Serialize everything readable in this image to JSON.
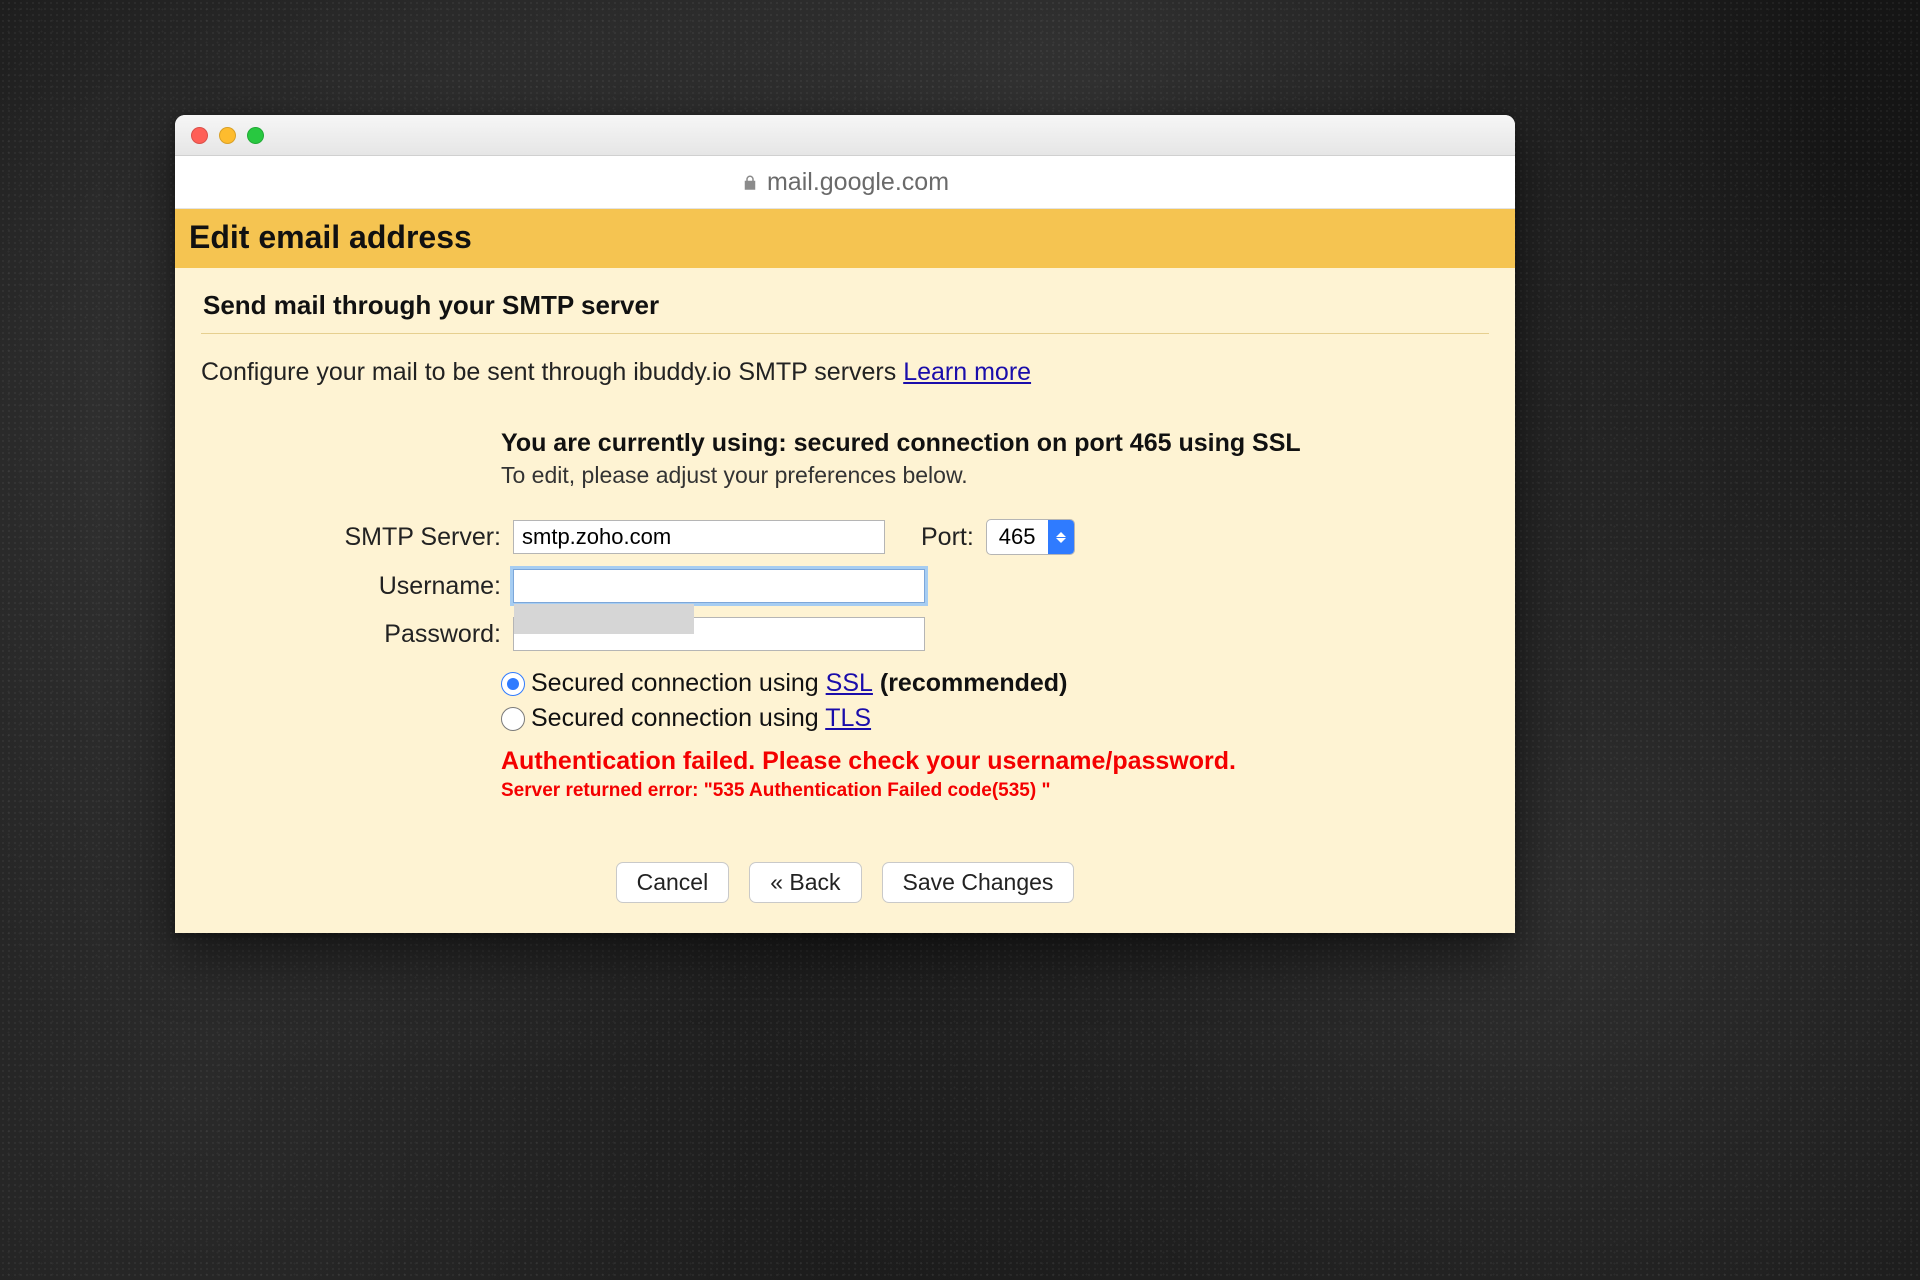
{
  "addressbar": {
    "host": "mail.google.com"
  },
  "header": {
    "title": "Edit email address"
  },
  "section": {
    "title": "Send mail through your SMTP server"
  },
  "config_line": {
    "text": "Configure your mail to be sent through ibuddy.io SMTP servers ",
    "link": "Learn more"
  },
  "status": {
    "bold": "You are currently using: secured connection on port 465 using SSL",
    "sub": "To edit, please adjust your preferences below."
  },
  "labels": {
    "smtp": "SMTP Server:",
    "port": "Port:",
    "username": "Username:",
    "password": "Password:"
  },
  "values": {
    "smtp": "smtp.zoho.com",
    "port": "465",
    "username": "",
    "password": ""
  },
  "radios": {
    "ssl_prefix": "Secured connection using ",
    "ssl_link": "SSL",
    "ssl_suffix": " (recommended)",
    "tls_prefix": "Secured connection using ",
    "tls_link": "TLS"
  },
  "error": {
    "main": "Authentication failed. Please check your username/password.",
    "detail": "Server returned error: \"535 Authentication Failed code(535) \""
  },
  "buttons": {
    "cancel": "Cancel",
    "back": "« Back",
    "save": "Save Changes"
  }
}
